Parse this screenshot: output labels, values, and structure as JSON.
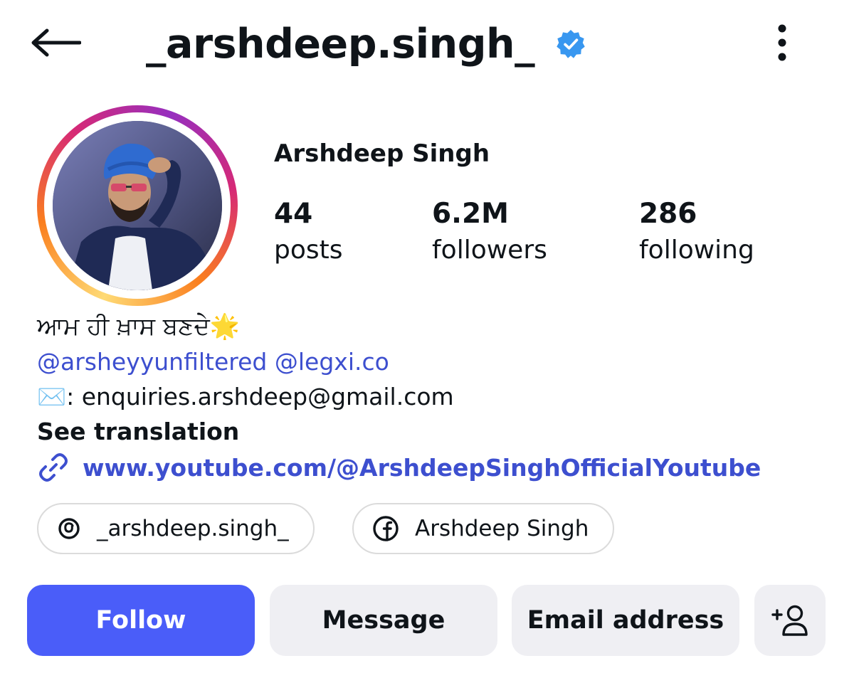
{
  "header": {
    "username": "_arshdeep.singh_",
    "verified": true,
    "back_icon": "arrow-left-icon",
    "more_icon": "more-vertical-icon"
  },
  "profile": {
    "display_name": "Arshdeep Singh",
    "stats": [
      {
        "value": "44",
        "label": "posts"
      },
      {
        "value": "6.2M",
        "label": "followers"
      },
      {
        "value": "286",
        "label": "following"
      }
    ]
  },
  "bio": {
    "tagline": "ਆਮ ਹੀ ਖ਼ਾਸ ਬਣਦੇ",
    "tagline_emoji": "🌟",
    "mentions": [
      "@arsheyyunfiltered",
      "@legxi.co"
    ],
    "email_prefix": "✉️",
    "email_line": ": enquiries.arshdeep@gmail.com",
    "see_translation": "See translation",
    "link": "www.youtube.com/@ArshdeepSinghOfficialYoutube",
    "link_icon": "link-icon"
  },
  "chips": [
    {
      "icon": "threads-icon",
      "label": "_arshdeep.singh_"
    },
    {
      "icon": "facebook-icon",
      "label": "Arshdeep Singh"
    }
  ],
  "actions": {
    "follow": "Follow",
    "message": "Message",
    "email": "Email address",
    "add_user_icon": "add-user-icon"
  },
  "colors": {
    "accent": "#4a5df9",
    "link": "#3d4fcf",
    "verified": "#3897f0",
    "button_secondary": "#efeff3",
    "chip_border": "#dbdbdb"
  }
}
